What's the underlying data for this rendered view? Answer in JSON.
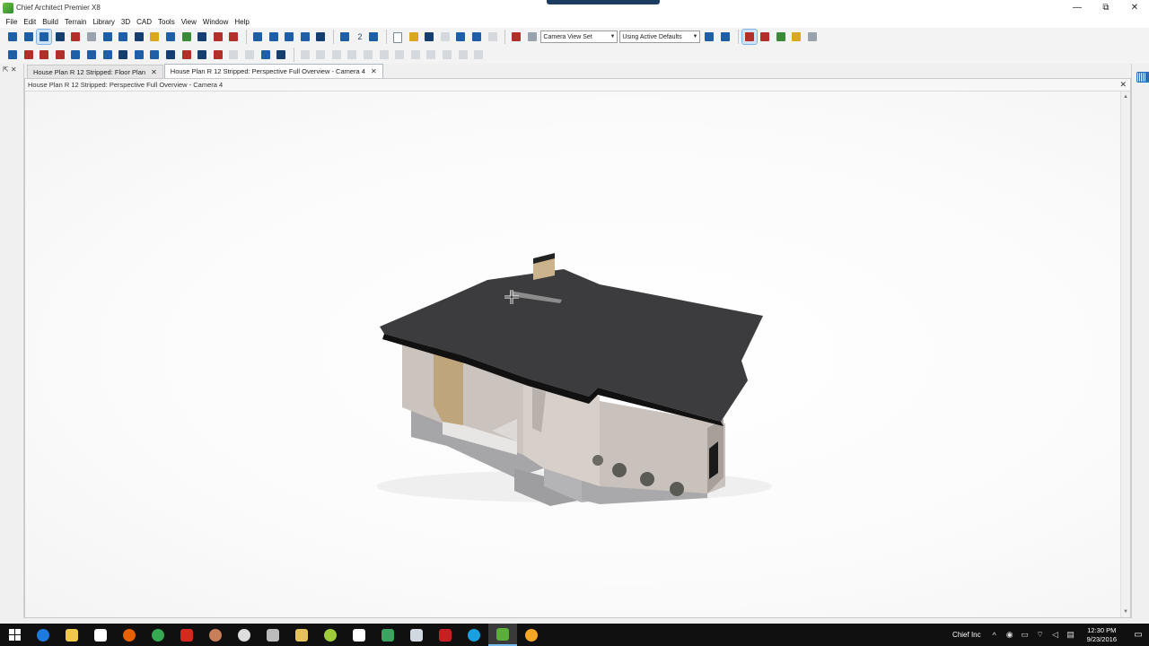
{
  "window": {
    "title": "Chief Architect Premier X8",
    "minimize": "—",
    "restore": "⧉",
    "close": "✕"
  },
  "menu": [
    "File",
    "Edit",
    "Build",
    "Terrain",
    "Library",
    "3D",
    "CAD",
    "Tools",
    "View",
    "Window",
    "Help"
  ],
  "toolbar": {
    "floor_number": "2",
    "camera_view_set": "Camera View Set",
    "active_defaults": "Using Active Defaults"
  },
  "tabs": [
    {
      "label": "House Plan R 12 Stripped: Floor Plan",
      "active": false
    },
    {
      "label": "House Plan R 12 Stripped: Perspective Full Overview - Camera 4",
      "active": true
    }
  ],
  "document": {
    "title": "House Plan R 12 Stripped: Perspective Full Overview - Camera 4",
    "close": "✕"
  },
  "taskbar": {
    "tray_label": "Chief Inc",
    "time": "12:30 PM",
    "date": "9/23/2016"
  },
  "colors": {
    "titlebar_bg": "#ffffff",
    "taskbar_bg": "#101010",
    "roof": "#3c3c3e",
    "wall": "#cfc6c0",
    "foundation": "#a9a9aa",
    "chimney_stone": "#cbb48d"
  }
}
